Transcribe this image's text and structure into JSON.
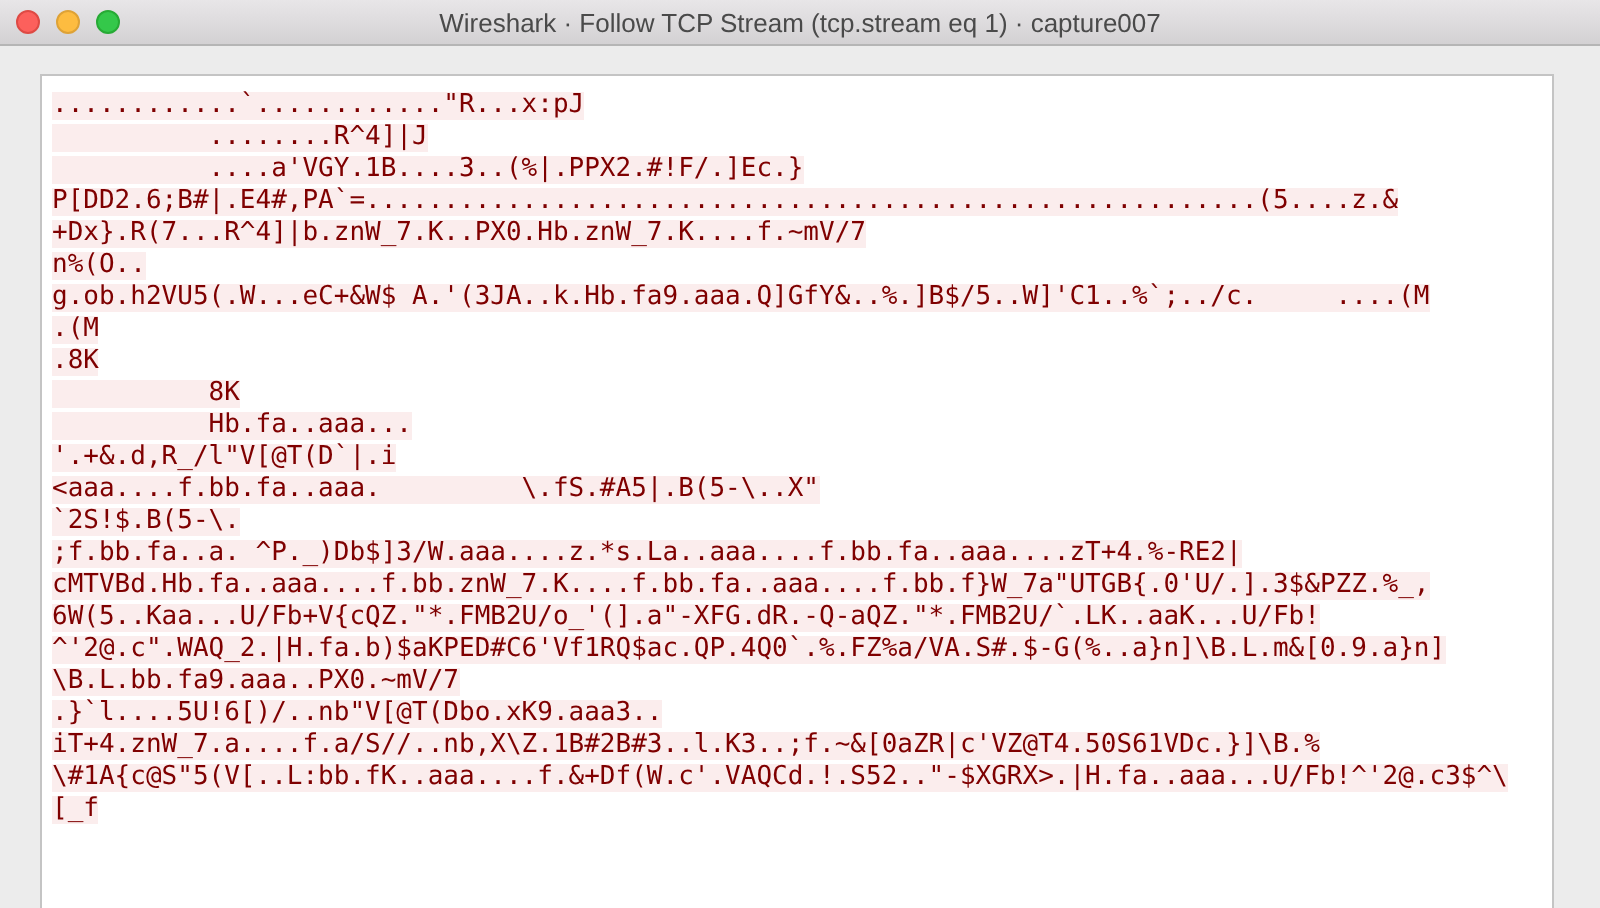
{
  "window": {
    "title": "Wireshark · Follow TCP Stream (tcp.stream eq 1) · capture007"
  },
  "stream": {
    "lines": [
      {
        "kind": "client",
        "text": "............`............\"R...x:pJ"
      },
      {
        "kind": "client",
        "text": "          ........R^4]|J"
      },
      {
        "kind": "client",
        "text": "          ....a'VGY.1B....3..(%|.PPX2.#!F/.]Ec.}"
      },
      {
        "kind": "client",
        "text": "P[DD2.6;B#|.E4#,PA`=.........................................................(5....z.&"
      },
      {
        "kind": "client",
        "text": "+Dx}.R(7...R^4]|b.znW_7.K..PX0.Hb.znW_7.K....f.~mV/7"
      },
      {
        "kind": "client",
        "text": "n%(O.."
      },
      {
        "kind": "client",
        "text": "g.ob.h2VU5(.W...eC+&W$ A.'(3JA..k.Hb.fa9.aaa.Q]GfY&..%.]B$/5..W]'C1..%`;../c.     ....(M"
      },
      {
        "kind": "client",
        "text": ".(M"
      },
      {
        "kind": "client",
        "text": ".8K"
      },
      {
        "kind": "client",
        "text": "          8K"
      },
      {
        "kind": "client",
        "text": "          Hb.fa..aaa..."
      },
      {
        "kind": "client",
        "text": "'.+&.d,R_/l\"V[@T(D`|.i"
      },
      {
        "kind": "client",
        "text": "<aaa....f.bb.fa..aaa.         \\.fS.#A5|.B(5-\\..X\""
      },
      {
        "kind": "client",
        "text": "`2S!$.B(5-\\."
      },
      {
        "kind": "client",
        "text": ";f.bb.fa..a. ^P._)Db$]3/W.aaa....z.*s.La..aaa....f.bb.fa..aaa....zT+4.%-RE2|"
      },
      {
        "kind": "client",
        "text": "cMTVBd.Hb.fa..aaa....f.bb.znW_7.K....f.bb.fa..aaa....f.bb.f}W_7a\"UTGB{.0'U/.].3$&PZZ.%_,"
      },
      {
        "kind": "client",
        "text": "6W(5..Kaa...U/Fb+V{cQZ.\"*.FMB2U/o_'(].a\"-XFG.dR.-Q-aQZ.\"*.FMB2U/`.LK..aaK...U/Fb!"
      },
      {
        "kind": "client",
        "text": "^'2@.c\".WAQ_2.|H.fa.b)$aKPED#C6'Vf1RQ$ac.QP.4Q0`.%.FZ%a/VA.S#.$-G(%..a}n]\\B.L.m&[0.9.a}n]"
      },
      {
        "kind": "client",
        "text": "\\B.L.bb.fa9.aaa..PX0.~mV/7"
      },
      {
        "kind": "client",
        "text": ".}`l....5U!6[)/..nb\"V[@T(Dbo.xK9.aaa3.."
      },
      {
        "kind": "client",
        "text": "iT+4.znW_7.a....f.a/S//..nb,X\\Z.1B#2B#3..l.K3..;f.~&[0aZR|c'VZ@T4.50S61VDc.}]\\B.%"
      },
      {
        "kind": "client",
        "text": "\\#1A{c@S\"5(V[..L:bb.fK..aaa....f.&+Df(W.c'.VAQCd.!.S52..\"-$XGRX>.|H.fa..aaa...U/Fb!^'2@.c3$^\\"
      },
      {
        "kind": "client",
        "text": "[_f"
      }
    ]
  }
}
